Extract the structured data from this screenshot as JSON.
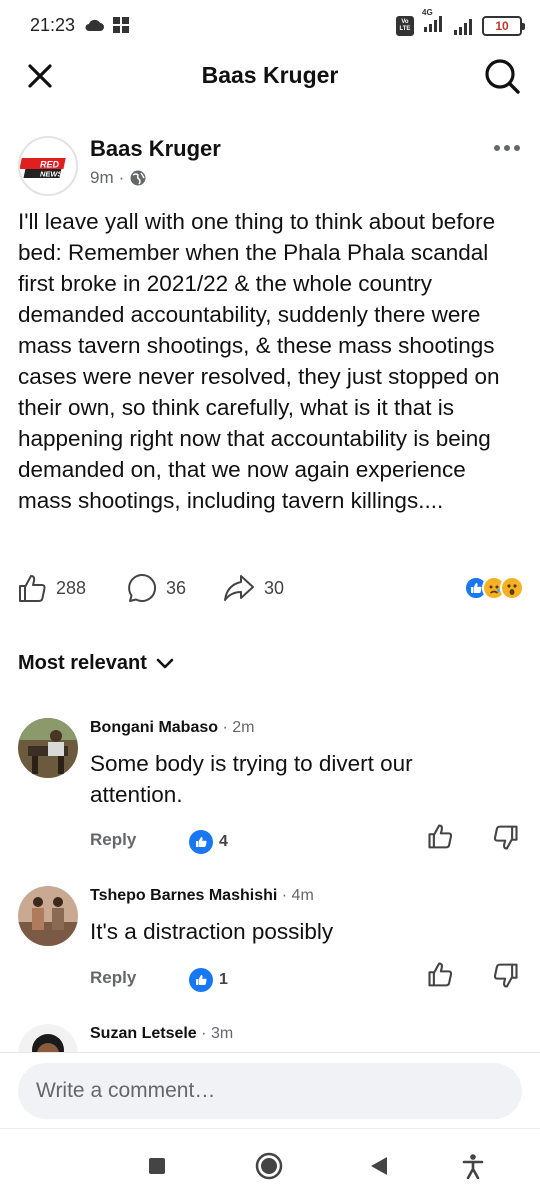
{
  "status_bar": {
    "time": "21:23",
    "network": "4G",
    "volte": "Vo LTE",
    "battery": "10"
  },
  "header": {
    "title": "Baas Kruger"
  },
  "post": {
    "author": "Baas Kruger",
    "avatar_text_top": "RED",
    "avatar_text_bottom": "NEWS",
    "time": "9m",
    "text": "I'll leave yall with one thing to think about before bed: Remember when the Phala Phala scandal first broke in 2021/22 & the whole country demanded accountability, suddenly there were mass tavern shootings, & these mass shootings cases were never resolved, they just stopped on their own, so think carefully, what is it that is happening right now that accountability is being demanded on, that we now again experience mass shootings, including tavern killings....",
    "likes": "288",
    "comments": "36",
    "shares": "30",
    "reaction_icons": [
      "like-icon",
      "sad-icon",
      "wow-icon"
    ]
  },
  "sort": {
    "label": "Most relevant"
  },
  "comments": [
    {
      "name": "Bongani Mabaso",
      "time": "2m",
      "text": "Some body is trying to divert our attention.",
      "reply_label": "Reply",
      "likes": "4"
    },
    {
      "name": "Tshepo Barnes Mashishi",
      "time": "4m",
      "text": "It's a distraction possibly",
      "reply_label": "Reply",
      "likes": "1"
    },
    {
      "name": "Suzan Letsele",
      "time": "3m"
    }
  ],
  "comment_box": {
    "placeholder": "Write a comment…"
  },
  "colors": {
    "brand_blue": "#1877f2",
    "reaction_yellow": "#f7b125",
    "red_news": "#e02020"
  }
}
